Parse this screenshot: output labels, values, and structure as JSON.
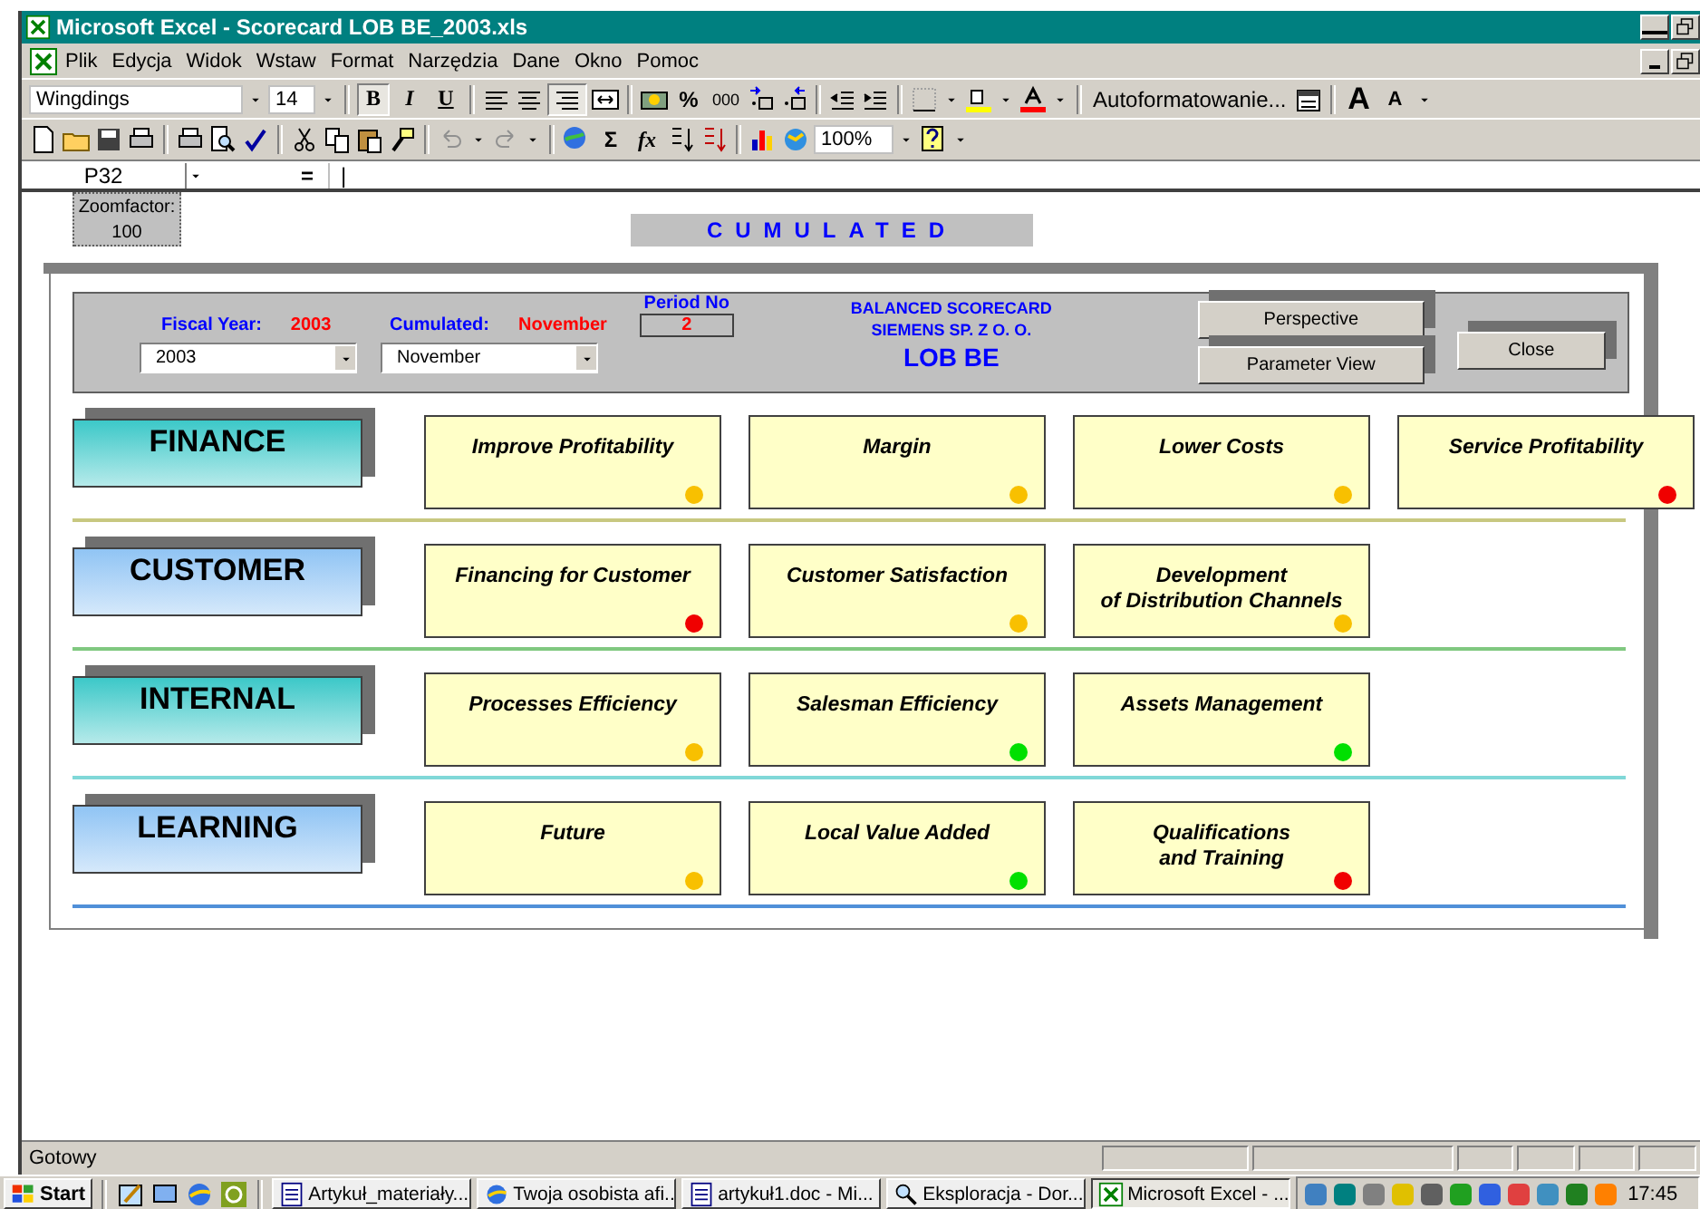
{
  "window": {
    "title": "Microsoft Excel - Scorecard LOB BE_2003.xls"
  },
  "menu": [
    "Plik",
    "Edycja",
    "Widok",
    "Wstaw",
    "Format",
    "Narzędzia",
    "Dane",
    "Okno",
    "Pomoc"
  ],
  "formatting_toolbar": {
    "font": "Wingdings",
    "size": "14",
    "bold": "B",
    "italic": "I",
    "underline": "U",
    "percent": "%",
    "thousands": "000",
    "autoformat": "Autoformatowanie...",
    "grow_font": "A",
    "shrink_font": "A"
  },
  "standard_toolbar": {
    "sum": "Σ",
    "function": "fx",
    "zoom": "100%"
  },
  "formula_bar": {
    "cell": "P32",
    "equals": "=",
    "content": "|"
  },
  "sheet": {
    "zoom_label": "Zoomfactor:",
    "zoom_value": "100",
    "banner": "CUMULATED",
    "header": {
      "fiscal_year_label": "Fiscal Year:",
      "fiscal_year_value": "2003",
      "fiscal_year_select": "2003",
      "cumulated_label": "Cumulated:",
      "cumulated_value": "November",
      "cumulated_select": "November",
      "period_label": "Period No",
      "period_value": "2",
      "title_lines": [
        "BALANCED SCORECARD",
        "SIEMENS SP. Z O. O."
      ],
      "unit": "LOB BE",
      "buttons": [
        "Perspective",
        "Parameter View",
        "Close"
      ]
    },
    "perspectives": [
      {
        "name": "FINANCE",
        "color": "#3cc8c8",
        "divider": {
          "color": "#c8c880"
        },
        "objectives": [
          {
            "title": "Improve Profitability",
            "color": "#f8c000"
          },
          {
            "title": "Margin",
            "color": "#f8c000"
          },
          {
            "title": "Lower Costs",
            "color": "#f8c000"
          },
          {
            "title": "Service Profitability",
            "color": "#f00000"
          }
        ]
      },
      {
        "name": "CUSTOMER",
        "color": "#90c4f4",
        "divider": {
          "color": "#80c880"
        },
        "objectives": [
          {
            "title": "Financing for Customer",
            "color": "#f00000"
          },
          {
            "title": "Customer Satisfaction",
            "color": "#f8c000"
          },
          {
            "title": "Development\nof Distribution Channels",
            "color": "#f8c000"
          }
        ]
      },
      {
        "name": "INTERNAL",
        "color": "#3cc8c8",
        "divider": {
          "color": "#80d8d8"
        },
        "objectives": [
          {
            "title": "Processes Efficiency",
            "color": "#f8c000"
          },
          {
            "title": "Salesman Efficiency",
            "color": "#00e000"
          },
          {
            "title": "Assets Management",
            "color": "#00e000"
          }
        ]
      },
      {
        "name": "LEARNING",
        "color": "#90c4f4",
        "divider": {
          "color": "#5090d8"
        },
        "objectives": [
          {
            "title": "Future",
            "color": "#f8c000"
          },
          {
            "title": "Local Value Added",
            "color": "#00e000"
          },
          {
            "title": "Qualifications\nand Training",
            "color": "#f00000"
          }
        ]
      }
    ]
  },
  "status_bar": {
    "text": "Gotowy"
  },
  "taskbar": {
    "start": "Start",
    "tasks": [
      {
        "label": "Artykuł_materiały...",
        "kind": "document",
        "selected": false
      },
      {
        "label": "Twoja osobista afi...",
        "kind": "browser",
        "selected": false
      },
      {
        "label": "artykuł1.doc - Mi...",
        "kind": "document",
        "selected": false
      },
      {
        "label": "Eksploracja - Dor...",
        "kind": "explorer",
        "selected": false
      },
      {
        "label": "Microsoft Excel - ...",
        "kind": "spreadsheet",
        "selected": true
      }
    ],
    "clock": "17:45"
  }
}
